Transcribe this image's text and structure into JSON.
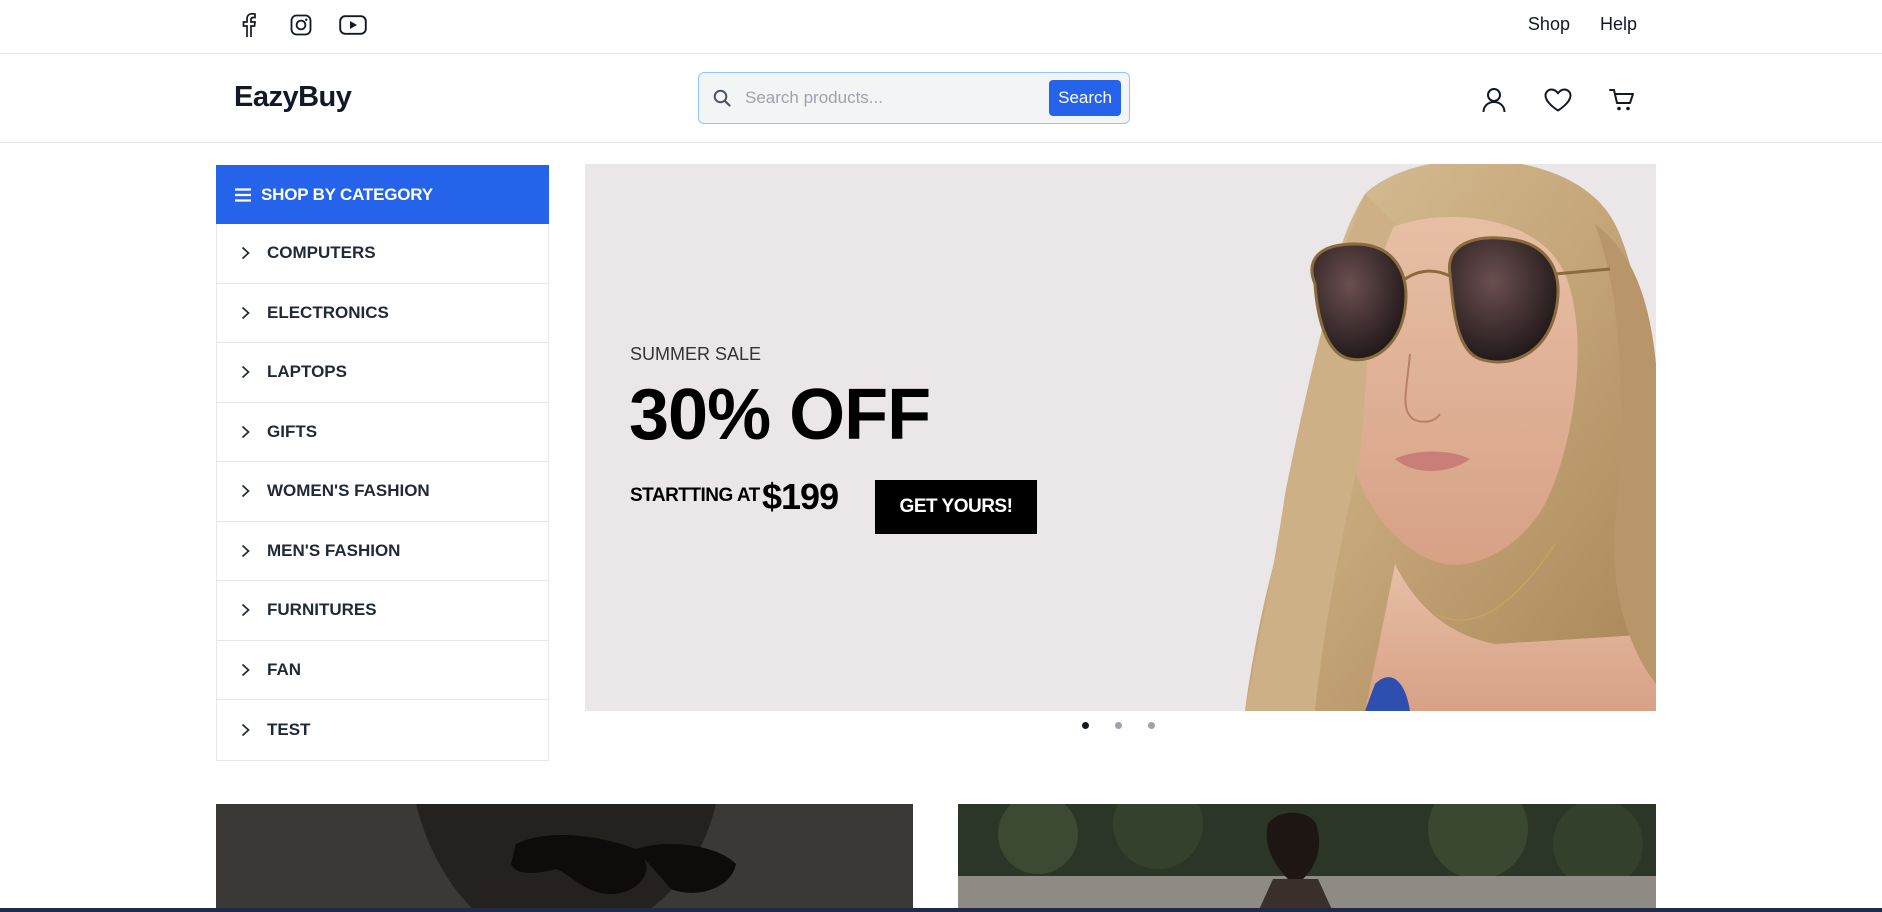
{
  "topbar": {
    "social": [
      "facebook-icon",
      "instagram-icon",
      "youtube-icon"
    ],
    "links": [
      "Shop",
      "Help"
    ]
  },
  "header": {
    "logo": "EazyBuy",
    "search": {
      "placeholder": "Search products...",
      "value": "",
      "button_label": "Search"
    },
    "icons": [
      "user-icon",
      "heart-icon",
      "cart-icon"
    ]
  },
  "categories": {
    "title": "SHOP BY CATEGORY",
    "items": [
      "COMPUTERS",
      "ELECTRONICS",
      "LAPTOPS",
      "GIFTS",
      "WOMEN'S FASHION",
      "MEN'S FASHION",
      "FURNITURES",
      "FAN",
      "TEST"
    ]
  },
  "banner": {
    "subtitle": "SUMMER SALE",
    "title": "30% OFF",
    "starting_label": "STARTTING AT",
    "price": "$199",
    "cta_label": "GET YOURS!",
    "slides": 3,
    "active_slide": 1
  },
  "colors": {
    "accent": "#2563eb",
    "banner_bg": "#ebe6e7",
    "cta_bg": "#000000"
  }
}
